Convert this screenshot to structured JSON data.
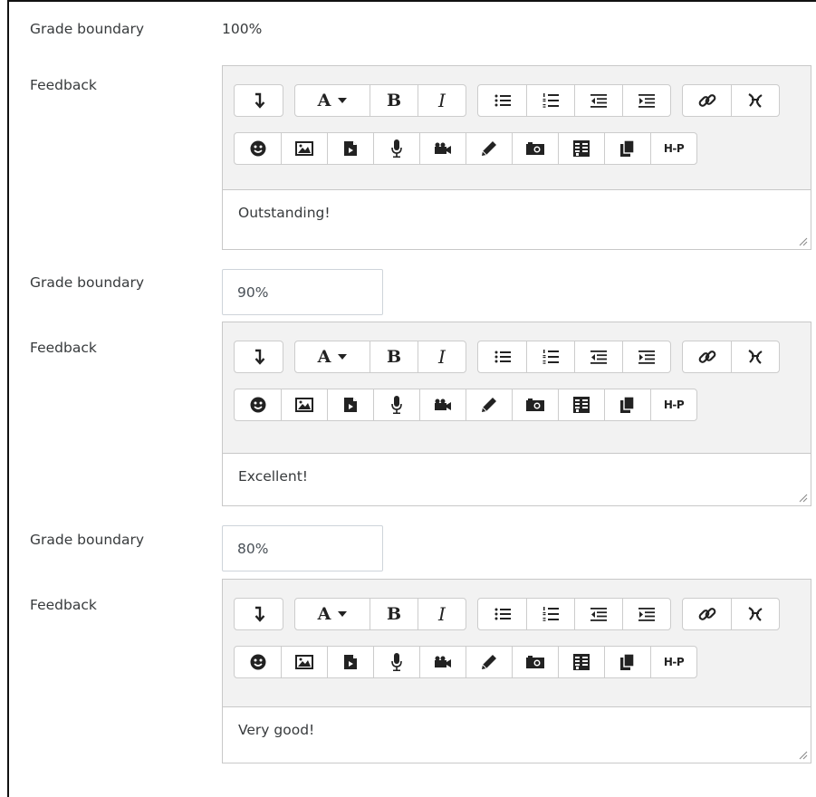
{
  "form": {
    "boundaries": [
      {
        "label": "Grade boundary",
        "value": "100%",
        "editable": false,
        "feedback_label": "Feedback",
        "feedback_text": "Outstanding!"
      },
      {
        "label": "Grade boundary",
        "value": "90%",
        "editable": true,
        "feedback_label": "Feedback",
        "feedback_text": "Excellent!"
      },
      {
        "label": "Grade boundary",
        "value": "80%",
        "editable": true,
        "feedback_label": "Feedback",
        "feedback_text": "Very good!"
      }
    ]
  },
  "toolbar": {
    "bold_label": "B",
    "italic_label": "I",
    "font_label": "A",
    "h5p_label": "H-P",
    "icons": {
      "collapse": "collapse-icon",
      "text_color": "text-color-icon",
      "bold": "bold-icon",
      "italic": "italic-icon",
      "unordered_list": "unordered-list-icon",
      "ordered_list": "ordered-list-icon",
      "outdent": "outdent-icon",
      "indent": "indent-icon",
      "link": "link-icon",
      "unlink": "unlink-icon",
      "emoticon": "emoticon-icon",
      "image": "image-icon",
      "media": "media-icon",
      "record_audio": "microphone-icon",
      "record_video": "video-camera-icon",
      "drawing": "pencil-icon",
      "screenshot": "camera-icon",
      "table": "table-icon",
      "paste": "paste-icon",
      "h5p": "h5p-icon"
    }
  },
  "colors": {
    "editor_background": "#f2f2f2",
    "border": "#cccccc",
    "text": "#373a3c",
    "icon": "#222222"
  }
}
